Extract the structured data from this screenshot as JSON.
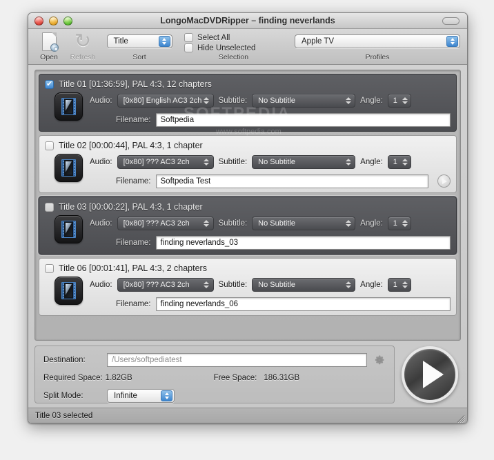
{
  "window": {
    "title": "LongoMacDVDRipper – finding neverlands",
    "close_label": "close",
    "minimize_label": "minimize",
    "zoom_label": "zoom",
    "toolbar_toggle_label": "toggle toolbar"
  },
  "toolbar": {
    "open_label": "Open",
    "refresh_label": "Refresh",
    "sort_caption": "Sort",
    "sort_value": "Title",
    "selection_caption": "Selection",
    "select_all_label": "Select All",
    "select_all_checked": false,
    "hide_unselected_label": "Hide Unselected",
    "hide_unselected_checked": false,
    "profiles_caption": "Profiles",
    "profile_value": "Apple TV"
  },
  "labels": {
    "audio": "Audio:",
    "subtitle": "Subtitle:",
    "angle": "Angle:",
    "filename": "Filename:"
  },
  "titles": [
    {
      "heading": "Title 01 [01:36:59], PAL 4:3, 12 chapters",
      "checked": true,
      "selected": false,
      "theme": "dark",
      "audio": "[0x80] English AC3 2ch",
      "subtitle": "No Subtitle",
      "angle": "1",
      "filename": "Softpedia",
      "has_preview": false
    },
    {
      "heading": "Title 02 [00:00:44], PAL 4:3, 1 chapter",
      "checked": false,
      "selected": false,
      "theme": "light",
      "audio": "[0x80] ??? AC3 2ch",
      "subtitle": "No Subtitle",
      "angle": "1",
      "filename": "Softpedia Test",
      "has_preview": true
    },
    {
      "heading": "Title 03 [00:00:22], PAL 4:3, 1 chapter",
      "checked": false,
      "selected": true,
      "theme": "dark",
      "audio": "[0x80] ??? AC3 2ch",
      "subtitle": "No Subtitle",
      "angle": "1",
      "filename": "finding neverlands_03",
      "has_preview": false
    },
    {
      "heading": "Title 06 [00:01:41], PAL 4:3, 2 chapters",
      "checked": false,
      "selected": false,
      "theme": "light",
      "audio": "[0x80] ??? AC3 2ch",
      "subtitle": "No Subtitle",
      "angle": "1",
      "filename": "finding neverlands_06",
      "has_preview": false
    }
  ],
  "bottom": {
    "destination_label": "Destination:",
    "destination_value": "/Users/softpediatest",
    "required_space_label": "Required Space:",
    "required_space_value": "1.82GB",
    "free_space_label": "Free Space:",
    "free_space_value": "186.31GB",
    "split_mode_label": "Split Mode:",
    "split_mode_value": "Infinite",
    "settings_icon": "gear-icon",
    "start_icon": "play-icon"
  },
  "status": {
    "text": "Title 03 selected"
  },
  "watermark": {
    "line1": "SOFTPEDIA",
    "line2": "www.softpedia.com"
  },
  "colors": {
    "accent": "#3d86cf",
    "dark_row": "#55565a",
    "light_row": "#e7e7e7"
  }
}
